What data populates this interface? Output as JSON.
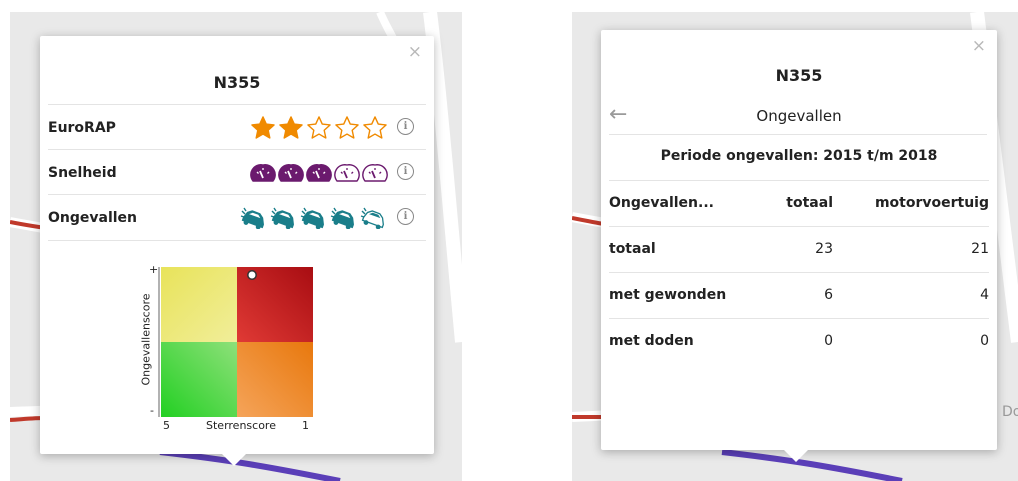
{
  "left_panel": {
    "close_icon": "×",
    "road": "N355",
    "rows": [
      {
        "label": "EuroRAP",
        "icon": "star-icon",
        "filled": 2,
        "total": 5,
        "color": "#f08a00"
      },
      {
        "label": "Snelheid",
        "icon": "speedometer-icon",
        "filled": 3,
        "total": 5,
        "color": "#6b1a6e"
      },
      {
        "label": "Ongevallen",
        "icon": "crashed-car-icon",
        "filled": 4,
        "total": 5,
        "color": "#1a7e8a"
      }
    ],
    "info_glyph": "i",
    "matrix": {
      "y_label": "Ongevallenscore",
      "y_plus": "+",
      "y_minus": "-",
      "x_label": "Sterrenscore",
      "x_left": "5",
      "x_right": "1",
      "colors": {
        "top_left": "#e8e35a",
        "top_right": "#c8141a",
        "bottom_left": "#2fd12f",
        "bottom_right": "#f08a17"
      }
    }
  },
  "right_panel": {
    "close_icon": "×",
    "road": "N355",
    "back_icon": "←",
    "subtitle": "Ongevallen",
    "period": "Periode ongevallen: 2015 t/m 2018",
    "headers": [
      "Ongevallen...",
      "totaal",
      "motorvoertuig"
    ],
    "rows": [
      [
        "totaal",
        "23",
        "21"
      ],
      [
        "met gewonden",
        "6",
        "4"
      ],
      [
        "met doden",
        "0",
        "0"
      ]
    ]
  },
  "map": {
    "label_right": "Do",
    "route_color": "#5b3fb8",
    "road_red": "#c0392b"
  }
}
